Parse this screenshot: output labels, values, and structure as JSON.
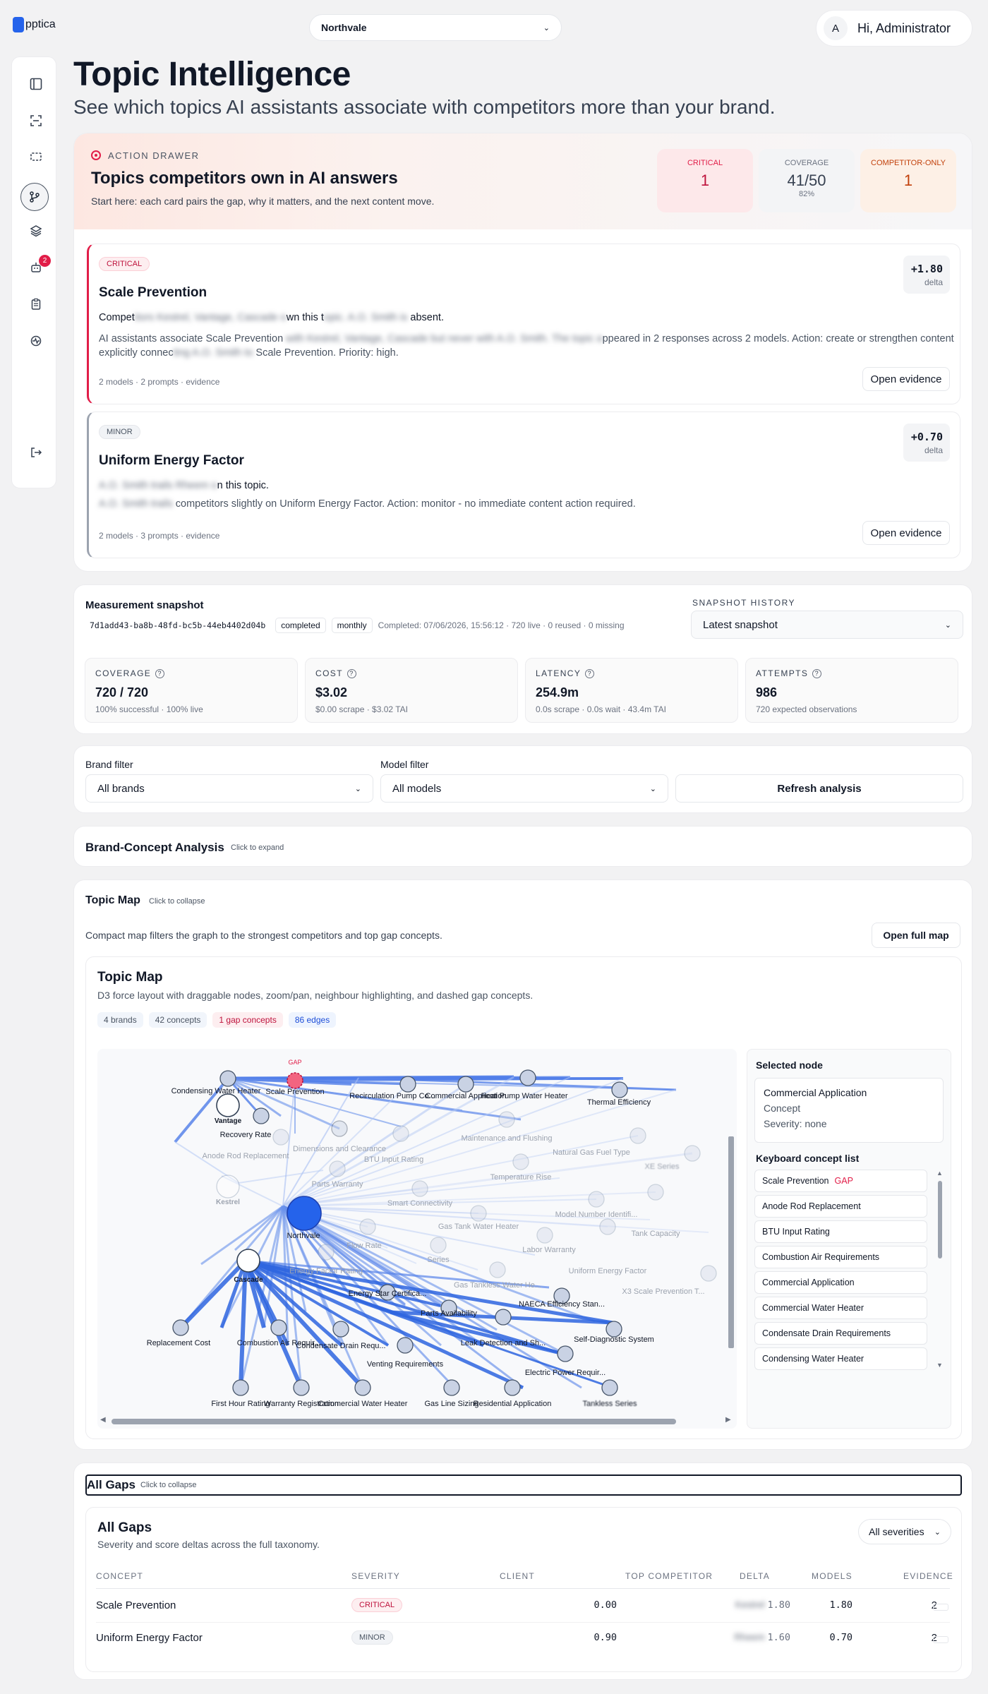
{
  "logo": "pptica",
  "workspace": "Northvale",
  "user": {
    "initial": "A",
    "greeting": "Hi, Administrator"
  },
  "sidebar_badge": "2",
  "page": {
    "title": "Topic Intelligence",
    "subtitle": "See which topics AI assistants associate with competitors more than your brand."
  },
  "drawer": {
    "eyebrow": "ACTION DRAWER",
    "title": "Topics competitors own in AI answers",
    "desc": "Start here: each card pairs the gap, why it matters, and the next content move.",
    "stats": [
      {
        "label": "CRITICAL",
        "value": "1",
        "sub": ""
      },
      {
        "label": "COVERAGE",
        "value": "41/50",
        "sub": "82%"
      },
      {
        "label": "COMPETITOR-ONLY",
        "value": "1",
        "sub": ""
      }
    ],
    "cards": [
      {
        "severity": "CRITICAL",
        "title": "Scale Prevention",
        "delta": "+1.80",
        "delta_label": "delta",
        "l1a": "Compet",
        "l1b": "itors Kestrel, Vantage, Cascade o",
        "l1c": "wn this t",
        "l1d": "opic. A.O. Smith is",
        "l1e": " absent.",
        "l2a": "AI assistants associate Scale Prevention ",
        "l2b": "with Kestrel, Vantage, Cascade but never",
        "l2c": " with A.O. Smith. The topic a",
        "l2d": "ppeared in 2 responses across 2 models. Action: create or strengthen content",
        "l3a": "explicitly connec",
        "l3b": "ting A.O. Smith to",
        "l3c": " Scale Prevention. Priority: high.",
        "meta": "2 models · 2 prompts · evidence",
        "button": "Open evidence"
      },
      {
        "severity": "MINOR",
        "title": "Uniform Energy Factor",
        "delta": "+0.70",
        "delta_label": "delta",
        "l1a": "A.O. Smith trails Rheem o",
        "l1b": "n this topic.",
        "l2a": "A.O. Smith trails",
        "l2b": " competitors slightly on Uniform Energy Factor. Action: monitor - no immediate content action required.",
        "meta": "2 models · 3 prompts · evidence",
        "button": "Open evidence"
      }
    ]
  },
  "snapshot": {
    "title": "Measurement snapshot",
    "id": "7d1add43-ba8b-48fd-bc5b-44eb4402d04b",
    "status": "completed",
    "cadence": "monthly",
    "meta": "Completed: 07/06/2026, 15:56:12 · 720 live · 0 reused · 0 missing",
    "history_label": "SNAPSHOT HISTORY",
    "history_value": "Latest snapshot",
    "metrics": [
      {
        "label": "COVERAGE",
        "value": "720 / 720",
        "sub": "100% successful · 100% live"
      },
      {
        "label": "COST",
        "value": "$3.02",
        "sub": "$0.00 scrape · $3.02 TAI"
      },
      {
        "label": "LATENCY",
        "value": "254.9m",
        "sub": "0.0s scrape · 0.0s wait · 43.4m TAI"
      },
      {
        "label": "ATTEMPTS",
        "value": "986",
        "sub": "720 expected observations"
      }
    ]
  },
  "filters": {
    "brand_label": "Brand filter",
    "brand_value": "All brands",
    "model_label": "Model filter",
    "model_value": "All models",
    "refresh": "Refresh analysis"
  },
  "bca": {
    "title": "Brand-Concept Analysis",
    "hint": "Click to expand"
  },
  "topicmap_section": {
    "title": "Topic Map",
    "hint": "Click to collapse",
    "desc": "Compact map filters the graph to the strongest competitors and top gap concepts.",
    "button": "Open full map"
  },
  "topicmap": {
    "title": "Topic Map",
    "desc": "D3 force layout with draggable nodes, zoom/pan, neighbour highlighting, and dashed gap concepts.",
    "chips": [
      "4 brands",
      "42 concepts",
      "1 gap concepts",
      "86 edges"
    ],
    "gap_tag": "GAP",
    "nodes": {
      "cwh": "Condensing Water Heater",
      "sp": "Scale Prevention",
      "rp": "Recirculation Pump Co...",
      "ca": "Commercial Application",
      "hp": "Heat Pump Water Heater",
      "te": "Thermal Efficiency",
      "vantage": "Vantage",
      "rr": "Recovery Rate",
      "arr": "Anode Rod Replacement",
      "dc": "Dimensions and Clearance",
      "mf": "Maintenance and Flushing",
      "ng": "Natural Gas Fuel Type",
      "btu": "BTU Input Rating",
      "xe": "XE Series",
      "kestrel": "Kestrel",
      "pw": "Parts Warranty",
      "tr": "Temperature Rise",
      "sc": "Smart Connectivity",
      "mn": "Model Number Identifi...",
      "northvale": "Northvale",
      "gt": "Gas Tank Water Heater",
      "tc": "Tank Capacity",
      "fr": "Flow Rate",
      "lw": "Labor Warranty",
      "ser": "Series",
      "uef": "Uniform Energy Factor",
      "gtl": "Gas Tankless Water He...",
      "efr": "Energy Factor Rating",
      "cascade": "Cascade",
      "x3": "X3 Scale Prevention T...",
      "es": "Energy Star Certifica...",
      "naeca": "NAECA Efficiency Stan...",
      "pa": "Parts Availability",
      "rc": "Replacement Cost",
      "cai": "Combustion Air Requir...",
      "cdr": "Condensate Drain Requ...",
      "ld": "Leak Detection and Sh...",
      "sd": "Self-Diagnostic System",
      "vr": "Venting Requirements",
      "ep": "Electric Power Requir...",
      "fhr": "First Hour Rating",
      "wr": "Warranty Registration",
      "cwh2": "Commercial Water Heater",
      "gls": "Gas Line Sizing",
      "ra": "Residential Application",
      "ts": "Tankless Series"
    },
    "selected": {
      "header": "Selected node",
      "name": "Commercial Application",
      "type": "Concept",
      "severity": "Severity: none"
    },
    "kcl_title": "Keyboard concept list",
    "kcl": [
      "Scale Prevention",
      "Anode Rod Replacement",
      "BTU Input Rating",
      "Combustion Air Requirements",
      "Commercial Application",
      "Commercial Water Heater",
      "Condensate Drain Requirements",
      "Condensing Water Heater"
    ]
  },
  "gaps_section": {
    "title": "All Gaps",
    "hint": "Click to collapse"
  },
  "gaps": {
    "title": "All Gaps",
    "desc": "Severity and score deltas across the full taxonomy.",
    "filter": "All severities",
    "columns": [
      "CONCEPT",
      "SEVERITY",
      "CLIENT",
      "TOP COMPETITOR",
      "DELTA",
      "MODELS",
      "EVIDENCE"
    ],
    "rows": [
      {
        "concept": "Scale Prevention",
        "severity": "CRITICAL",
        "client": "0.00",
        "comp_name": "Kestrel",
        "comp_score": "1.80",
        "delta": "1.80",
        "models": "2"
      },
      {
        "concept": "Uniform Energy Factor",
        "severity": "MINOR",
        "client": "0.90",
        "comp_name": "Rheem",
        "comp_score": "1.60",
        "delta": "0.70",
        "models": "2"
      }
    ]
  },
  "colors": {
    "accent": "#2563eb",
    "critical": "#e11d48",
    "competitor": "#c2410c"
  }
}
